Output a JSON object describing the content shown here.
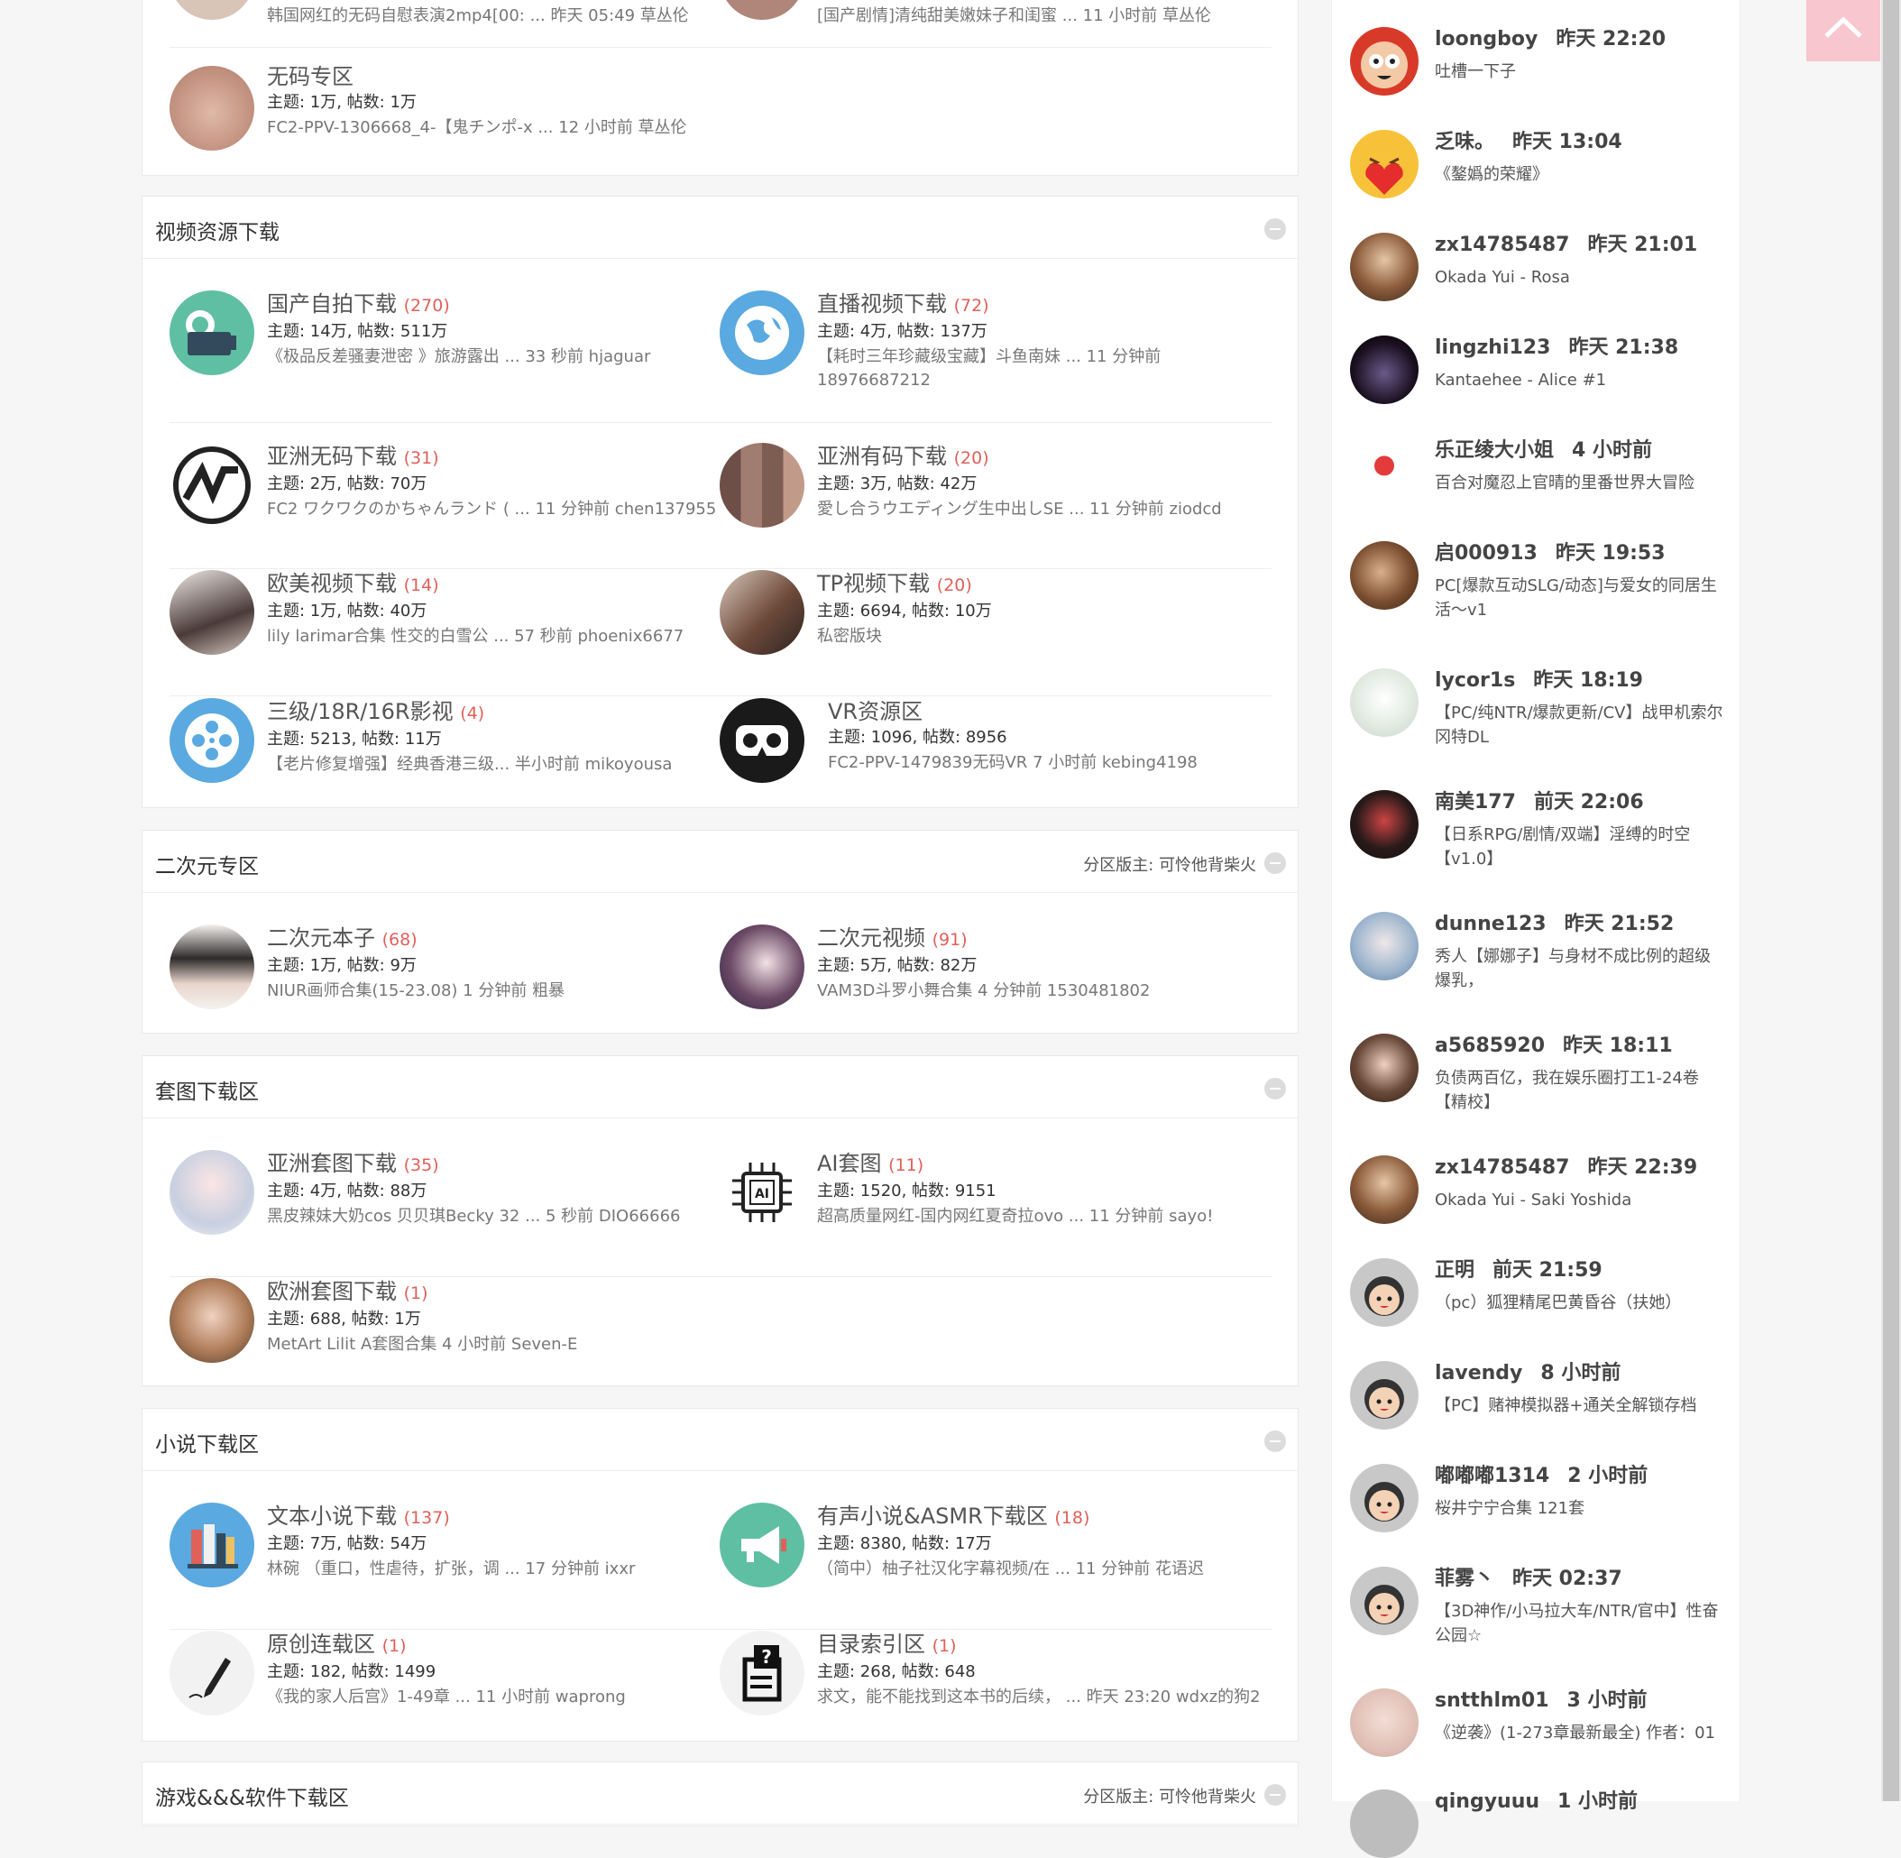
{
  "top_block": {
    "partial_row": [
      {
        "last": "韩国网红的无码自慰表演2mp4[00: ... 昨天 05:49 草丛伦"
      },
      {
        "last": "[国产剧情]清纯甜美嫩妹子和闺蜜 ... 11 小时前 草丛伦"
      }
    ],
    "forum": {
      "name": "无码专区",
      "count": "",
      "stats": "主题: 1万, 帖数: 1万",
      "last": "FC2-PPV-1306668_4-【鬼チンポ-x ... 12 小时前 草丛伦"
    }
  },
  "categories": [
    {
      "title": "视频资源下载",
      "moderator": "",
      "forums": [
        {
          "name": "国产自拍下载",
          "count": "(270)",
          "stats": "主题: 14万, 帖数: 511万",
          "last": "《极品反差骚妻泄密 》旅游露出 ... 33 秒前 hjaguar",
          "icon": "camera-icon"
        },
        {
          "name": "直播视频下载",
          "count": "(72)",
          "stats": "主题: 4万, 帖数: 137万",
          "last": "【耗时三年珍藏级宝藏】斗鱼南妹 ... 11 分钟前 18976687212",
          "icon": "globe-icon"
        },
        {
          "name": "亚洲无码下载",
          "count": "(31)",
          "stats": "主题: 2万, 帖数: 70万",
          "last": "FC2 ワクワクのかちゃんランド ( ... 11 分钟前 chen137955",
          "icon": "av-logo-icon"
        },
        {
          "name": "亚洲有码下载",
          "count": "(20)",
          "stats": "主题: 3万, 帖数: 42万",
          "last": "愛し合うウエディング生中出しSE ... 11 分钟前 ziodcd",
          "icon": "mosaic-icon"
        },
        {
          "name": "欧美视频下载",
          "count": "(14)",
          "stats": "主题: 1万, 帖数: 40万",
          "last": "lily larimar合集 性交的白雪公 ... 57 秒前 phoenix6677",
          "icon": "photo-icon"
        },
        {
          "name": "TP视频下载",
          "count": "(20)",
          "stats": "主题: 6694, 帖数: 10万",
          "last": "私密版块",
          "icon": "photo-icon"
        },
        {
          "name": "三级/18R/16R影视",
          "count": "(4)",
          "stats": "主题: 5213, 帖数: 11万",
          "last": "【老片修复增强】经典香港三级... 半小时前 mikoyousa",
          "icon": "film-reel-icon"
        },
        {
          "name": "VR资源区",
          "count": "",
          "stats": "主题: 1096, 帖数: 8956",
          "last": "FC2-PPV-1479839无码VR 7 小时前 kebing4198",
          "icon": "vr-goggles-icon"
        }
      ]
    },
    {
      "title": "二次元专区",
      "moderator": "分区版主: 可怜他背柴火",
      "forums": [
        {
          "name": "二次元本子",
          "count": "(68)",
          "stats": "主题: 1万, 帖数: 9万",
          "last": "NIUR画师合集(15-23.08) 1 分钟前 粗暴",
          "icon": "anime-icon"
        },
        {
          "name": "二次元视频",
          "count": "(91)",
          "stats": "主题: 5万, 帖数: 82万",
          "last": "VAM3D斗罗小舞合集 4 分钟前 1530481802",
          "icon": "anime-icon"
        }
      ]
    },
    {
      "title": "套图下载区",
      "moderator": "",
      "forums": [
        {
          "name": "亚洲套图下载",
          "count": "(35)",
          "stats": "主题: 4万, 帖数: 88万",
          "last": "黑皮辣妹大奶cos 贝贝琪Becky 32 ... 5 秒前 DIO66666",
          "icon": "photo-icon"
        },
        {
          "name": "AI套图",
          "count": "(11)",
          "stats": "主题: 1520, 帖数: 9151",
          "last": "超高质量网红-国内网红夏奇拉ovo ... 11 分钟前 sayo!",
          "icon": "ai-chip-icon"
        },
        {
          "name": "欧洲套图下载",
          "count": "(1)",
          "stats": "主题: 688, 帖数: 1万",
          "last": "MetArt Lilit A套图合集 4 小时前 Seven-E",
          "icon": "photo-icon"
        }
      ]
    },
    {
      "title": "小说下载区",
      "moderator": "",
      "forums": [
        {
          "name": "文本小说下载",
          "count": "(137)",
          "stats": "主题: 7万, 帖数: 54万",
          "last": "林碗 （重口，性虐待，扩张，调 ... 17 分钟前 ixxr",
          "icon": "books-icon"
        },
        {
          "name": "有声小说&ASMR下载区",
          "count": "(18)",
          "stats": "主题: 8380, 帖数: 17万",
          "last": "（简中）柚子社汉化字幕视频/在 ... 11 分钟前 花语迟",
          "icon": "megaphone-icon"
        },
        {
          "name": "原创连载区",
          "count": "(1)",
          "stats": "主题: 182, 帖数: 1499",
          "last": "《我的家人后宫》1-49章 ... 11 小时前 waprong",
          "icon": "pen-icon"
        },
        {
          "name": "目录索引区",
          "count": "(1)",
          "stats": "主题: 268, 帖数: 648",
          "last": "求文，能不能找到这本书的后续， ... 昨天 23:20 wdxz的狗2",
          "icon": "question-doc-icon"
        }
      ]
    },
    {
      "title": "游戏&&&软件下载区",
      "moderator": "分区版主: 可怜他背柴火",
      "forums": []
    }
  ],
  "recent_posts": [
    {
      "user": "loongboy",
      "time": "昨天 22:20",
      "title": "吐槽一下子",
      "avatar": "cartoon-face-icon"
    },
    {
      "user": "乏味。",
      "time": "昨天 13:04",
      "title": "《鏊嬀的荣耀》",
      "avatar": "emoji-heart-icon"
    },
    {
      "user": "zx14785487",
      "time": "昨天 21:01",
      "title": "Okada Yui - Rosa",
      "avatar": "photo-icon"
    },
    {
      "user": "lingzhi123",
      "time": "昨天 21:38",
      "title": "Kantaehee - Alice #1",
      "avatar": "drop-icon"
    },
    {
      "user": "乐正绫大小姐",
      "time": "4 小时前",
      "title": "百合对魔忍上官晴的里番世界大冒险",
      "avatar": "anime-icon"
    },
    {
      "user": "启000913",
      "time": "昨天 19:53",
      "title": "PC[爆款互动SLG/动态]与爱女的同居生活～v1",
      "avatar": "photo-icon"
    },
    {
      "user": "lycor1s",
      "time": "昨天 18:19",
      "title": "【PC/纯NTR/爆款更新/CV】战甲机索尔冈特DL",
      "avatar": "anime-icon"
    },
    {
      "user": "南美177",
      "time": "前天 22:06",
      "title": "【日系RPG/剧情/双端】淫缚的时空【v1.0】",
      "avatar": "photo-icon"
    },
    {
      "user": "dunne123",
      "time": "昨天 21:52",
      "title": "秀人【娜娜子】与身材不成比例的超级爆乳，",
      "avatar": "photo-icon"
    },
    {
      "user": "a5685920",
      "time": "昨天 18:11",
      "title": "负债两百亿，我在娱乐圈打工1-24卷【精校】",
      "avatar": "photo-icon"
    },
    {
      "user": "zx14785487",
      "time": "昨天 22:39",
      "title": "Okada Yui - Saki Yoshida",
      "avatar": "photo-icon"
    },
    {
      "user": "正明",
      "time": "前天 21:59",
      "title": "（pc）狐狸精尾巴黄昏谷（扶她）",
      "avatar": "default-avatar-icon"
    },
    {
      "user": "lavendy",
      "time": "8 小时前",
      "title": "【PC】赌神模拟器+通关全解锁存档",
      "avatar": "default-avatar-icon"
    },
    {
      "user": "嘟嘟嘟1314",
      "time": "2 小时前",
      "title": "桜井宁宁合集 121套",
      "avatar": "default-avatar-icon"
    },
    {
      "user": "菲雾丶",
      "time": "昨天 02:37",
      "title": "【3D神作/小马拉大车/NTR/官中】性奋公园☆",
      "avatar": "default-avatar-icon"
    },
    {
      "user": "sntthlm01",
      "time": "3 小时前",
      "title": "《逆袭》(1-273章最新最全) 作者：01",
      "avatar": "photo-icon"
    },
    {
      "user": "qingyuuu",
      "time": "1 小时前",
      "title": "",
      "avatar": "photo-icon"
    }
  ],
  "colors": {
    "count": "#e0605a",
    "totop": "#f7c6cf",
    "icon_teal": "#5fbfa3",
    "icon_blue": "#5aa9e0"
  }
}
